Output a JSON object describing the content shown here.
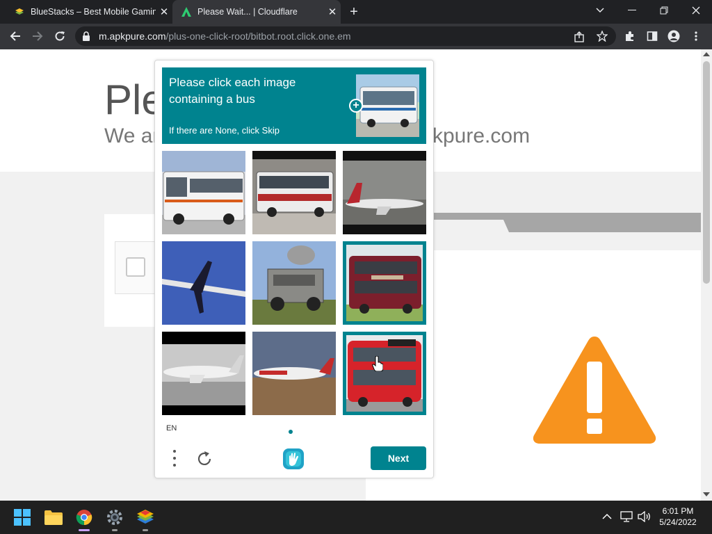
{
  "browser": {
    "tabs": [
      {
        "title": "BlueStacks – Best Mobile Gaming",
        "active": false
      },
      {
        "title": "Please Wait... | Cloudflare",
        "active": true
      }
    ],
    "url_host": "m.apkpure.com",
    "url_path": "/plus-one-click-root/bitbot.root.click.one.em"
  },
  "page": {
    "heading_partial": "Ple",
    "subtitle_left_partial": "We ar",
    "subtitle_right_partial": "kpure.com"
  },
  "captcha": {
    "prompt": "Please click each image containing a bus",
    "hint": "If there are None, click Skip",
    "language": "EN",
    "next_label": "Next",
    "tiles": [
      {
        "label": "white-bus",
        "selected": false
      },
      {
        "label": "red-white-bus",
        "selected": false
      },
      {
        "label": "airplane-taxiing",
        "selected": false
      },
      {
        "label": "airplane-flying",
        "selected": false
      },
      {
        "label": "armored-vehicle",
        "selected": false
      },
      {
        "label": "double-decker-bus-maroon",
        "selected": true
      },
      {
        "label": "airplane-runway",
        "selected": false
      },
      {
        "label": "airplane-red-livery",
        "selected": false
      },
      {
        "label": "double-decker-bus-red",
        "selected": true
      }
    ],
    "accent_color": "#00838f"
  },
  "taskbar": {
    "time": "6:01 PM",
    "date": "5/24/2022"
  },
  "colors": {
    "warning": "#f7931e",
    "chrome_dark": "#202124",
    "chrome_toolbar": "#35363a"
  }
}
